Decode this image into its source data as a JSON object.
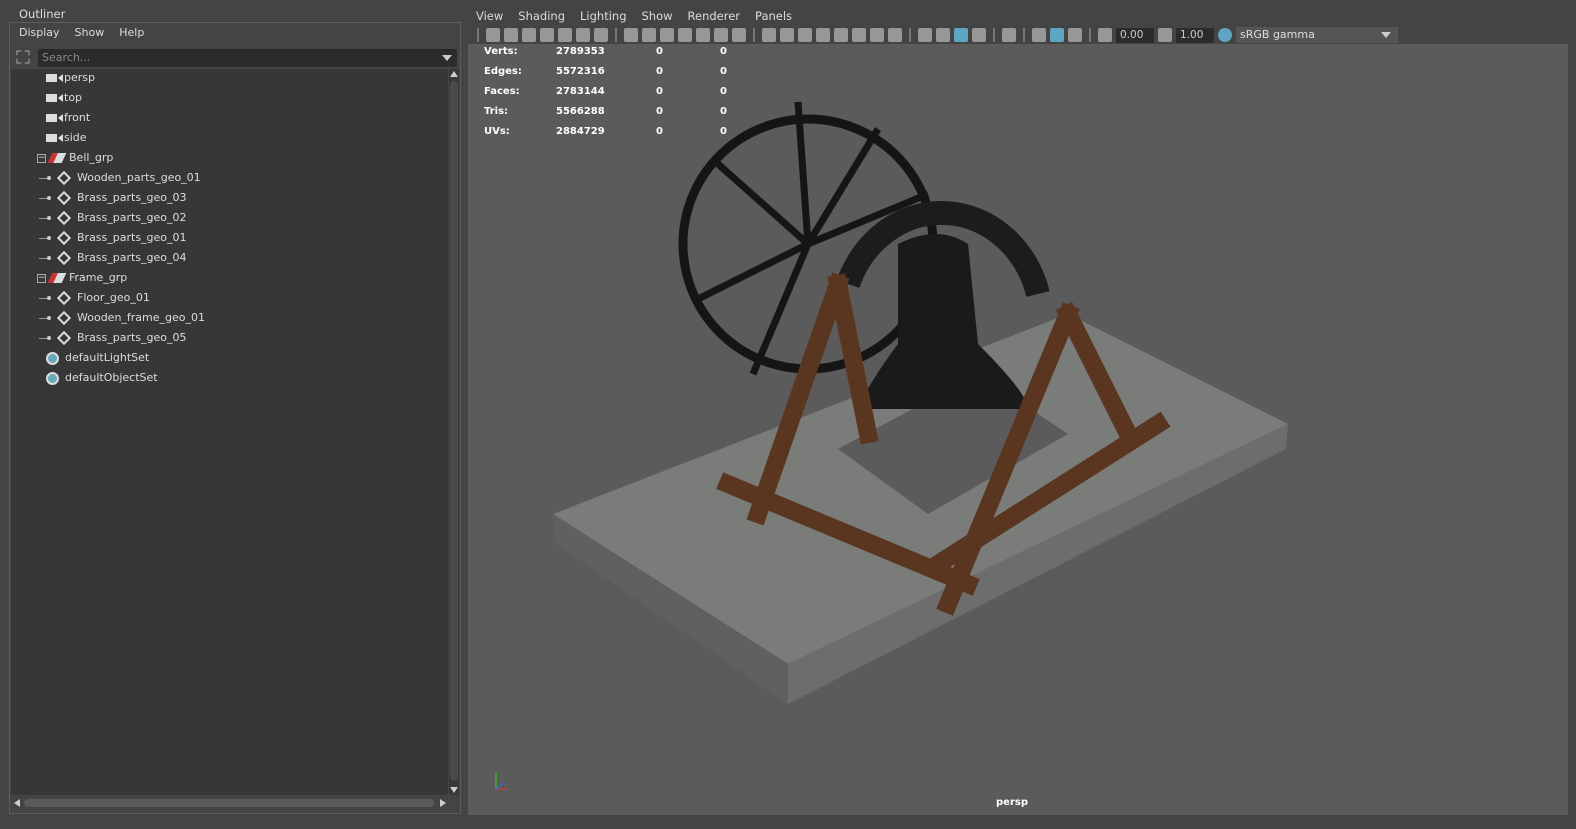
{
  "outliner": {
    "tab": "Outliner",
    "menu": [
      "Display",
      "Show",
      "Help"
    ],
    "search_placeholder": "Search...",
    "items": [
      {
        "label": "persp",
        "type": "camera",
        "level": 0
      },
      {
        "label": "top",
        "type": "camera",
        "level": 0
      },
      {
        "label": "front",
        "type": "camera",
        "level": 0
      },
      {
        "label": "side",
        "type": "camera",
        "level": 0
      },
      {
        "label": "Bell_grp",
        "type": "group",
        "level": 0,
        "expanded": true
      },
      {
        "label": "Wooden_parts_geo_01",
        "type": "mesh",
        "level": 1
      },
      {
        "label": "Brass_parts_geo_03",
        "type": "mesh",
        "level": 1
      },
      {
        "label": "Brass_parts_geo_02",
        "type": "mesh",
        "level": 1
      },
      {
        "label": "Brass_parts_geo_01",
        "type": "mesh",
        "level": 1
      },
      {
        "label": "Brass_parts_geo_04",
        "type": "mesh",
        "level": 1
      },
      {
        "label": "Frame_grp",
        "type": "group",
        "level": 0,
        "expanded": true
      },
      {
        "label": "Floor_geo_01",
        "type": "mesh",
        "level": 1
      },
      {
        "label": "Wooden_frame_geo_01",
        "type": "mesh",
        "level": 1
      },
      {
        "label": "Brass_parts_geo_05",
        "type": "mesh",
        "level": 1
      },
      {
        "label": "defaultLightSet",
        "type": "set",
        "level": 0
      },
      {
        "label": "defaultObjectSet",
        "type": "set",
        "level": 0
      }
    ]
  },
  "viewport": {
    "menu": [
      "View",
      "Shading",
      "Lighting",
      "Show",
      "Renderer",
      "Panels"
    ],
    "exposure": "0.00",
    "gamma": "1.00",
    "color_space": "sRGB gamma",
    "camera": "persp",
    "stats": [
      [
        "Verts:",
        "2789353",
        "0",
        "0"
      ],
      [
        "Edges:",
        "5572316",
        "0",
        "0"
      ],
      [
        "Faces:",
        "2783144",
        "0",
        "0"
      ],
      [
        "Tris:",
        "5566288",
        "0",
        "0"
      ],
      [
        "UVs:",
        "2884729",
        "0",
        "0"
      ]
    ]
  }
}
